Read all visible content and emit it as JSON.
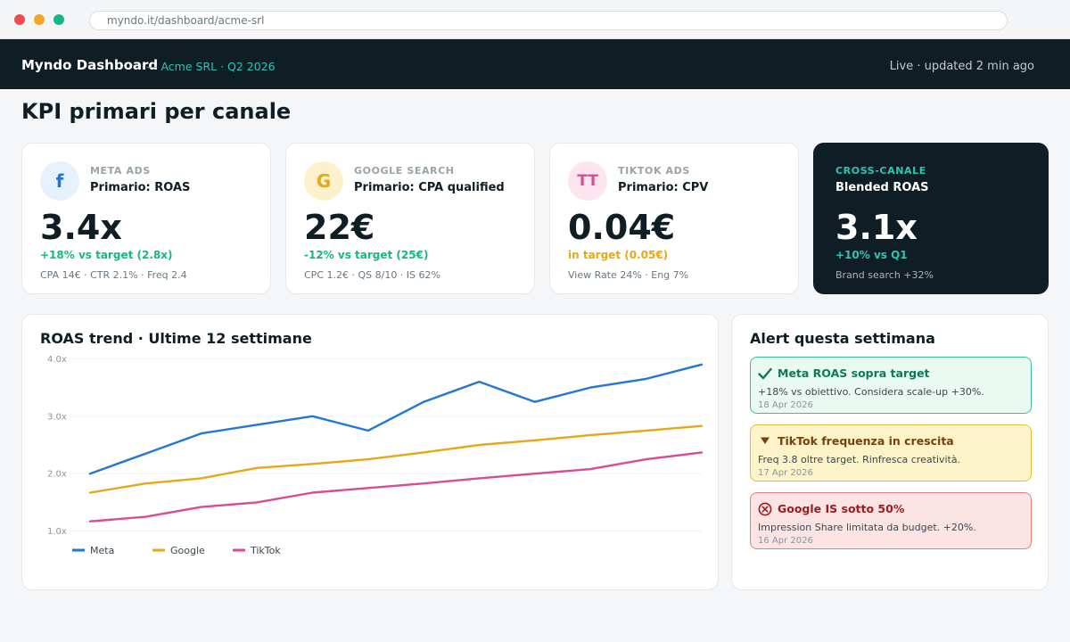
{
  "browser": {
    "url": "myndo.it/dashboard/acme-srl"
  },
  "nav": {
    "brand": "Myndo Dashboard",
    "context": "— Acme SRL · Q2 2026",
    "status": "Live · updated 2 min ago"
  },
  "page": {
    "title": "KPI primari per canale"
  },
  "cards": [
    {
      "badge": "f",
      "channel": "META ADS",
      "primary": "Primario: ROAS",
      "value": "3.4x",
      "delta": "+18% vs target (2.8x)",
      "delta_color": "#12b886",
      "sub": "CPA 14€ · CTR 2.1% · Freq 2.4",
      "badge_bg": "#e6f1fd",
      "badge_color": "#1f77d6"
    },
    {
      "badge": "G",
      "channel": "GOOGLE SEARCH",
      "primary": "Primario: CPA qualified",
      "value": "22€",
      "delta": "-12% vs target (25€)",
      "delta_color": "#12b886",
      "sub": "CPC 1.2€ · QS 8/10 · IS 62%",
      "badge_bg": "#fdf1cc",
      "badge_color": "#e6a817"
    },
    {
      "badge": "TT",
      "channel": "TIKTOK ADS",
      "primary": "Primario: CPV",
      "value": "0.04€",
      "delta": "in target (0.05€)",
      "delta_color": "#e6a817",
      "sub": "View Rate 24% · Eng 7%",
      "badge_bg": "#fde4ef",
      "badge_color": "#d94b95"
    },
    {
      "channel": "CROSS-CANALE",
      "primary": "Blended ROAS",
      "value": "3.1x",
      "delta": "+10% vs Q1",
      "delta_color": "#2ec4b6",
      "sub": "Brand search +32%"
    }
  ],
  "trend": {
    "title": "ROAS trend · Ultime 12 settimane"
  },
  "chart_data": {
    "type": "line",
    "x": [
      1,
      2,
      3,
      4,
      5,
      6,
      7,
      8,
      9,
      10,
      11,
      12
    ],
    "yticks": [
      "4.0x",
      "3.0x",
      "2.0x",
      "1.0x"
    ],
    "ylim": [
      0.7,
      4.3
    ],
    "grid": true,
    "legend_position": "bottom-left",
    "series": [
      {
        "name": "Meta",
        "color": "#1f77d6",
        "values": [
          2.0,
          2.35,
          2.7,
          2.85,
          3.0,
          2.75,
          3.25,
          3.6,
          3.25,
          3.5,
          3.65,
          3.9
        ]
      },
      {
        "name": "Google",
        "color": "#e6a817",
        "values": [
          1.67,
          1.83,
          1.92,
          2.1,
          2.17,
          2.25,
          2.37,
          2.5,
          2.58,
          2.67,
          2.75,
          2.83
        ]
      },
      {
        "name": "TikTok",
        "color": "#d94b95",
        "values": [
          1.17,
          1.25,
          1.42,
          1.5,
          1.67,
          1.75,
          1.83,
          1.92,
          2.0,
          2.08,
          2.25,
          2.37
        ]
      }
    ]
  },
  "alerts": {
    "title": "Alert questa settimana",
    "items": [
      {
        "icon": "check-icon",
        "title": "Meta ROAS sopra target",
        "text": "+18% vs obiettivo. Considera scale-up +30%.",
        "date": "18 Apr 2026",
        "bg": "#e9faf3",
        "border": "#39c08e",
        "title_color": "#0b7a55"
      },
      {
        "icon": "triangle-down-icon",
        "title": "TikTok frequenza in crescita",
        "text": "Freq 3.8 oltre target. Rinfresca creatività.",
        "date": "17 Apr 2026",
        "bg": "#fdf3c9",
        "border": "#e6b93b",
        "title_color": "#7a3e0b"
      },
      {
        "icon": "error-circle-icon",
        "title": "Google IS sotto 50%",
        "text": "Impression Share limitata da budget. +20%.",
        "date": "16 Apr 2026",
        "bg": "#fde4e4",
        "border": "#e77c7c",
        "title_color": "#9b1c1c"
      }
    ]
  }
}
